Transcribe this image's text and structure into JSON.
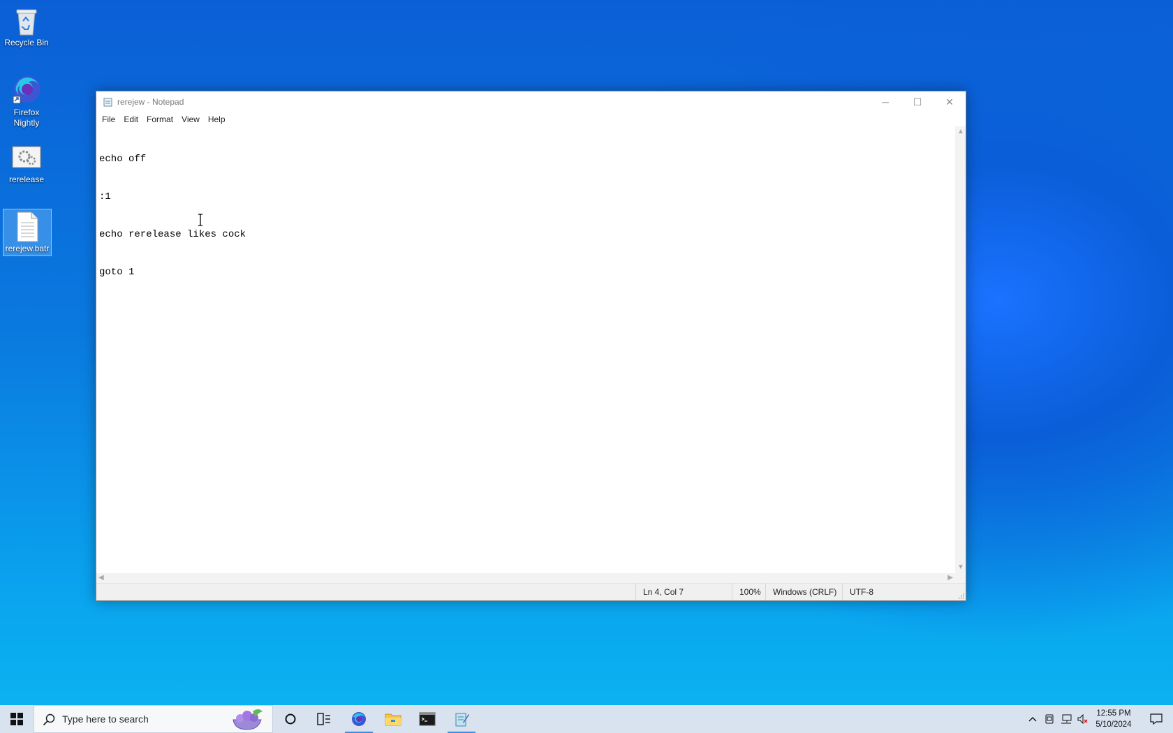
{
  "desktop": {
    "icons": [
      {
        "label": "Recycle Bin"
      },
      {
        "label": "Firefox Nightly"
      },
      {
        "label": "rerelease"
      },
      {
        "label": "rerejew.batr"
      }
    ]
  },
  "notepad": {
    "title": "rerejew - Notepad",
    "menu": [
      "File",
      "Edit",
      "Format",
      "View",
      "Help"
    ],
    "content_lines": [
      "echo off",
      ":1",
      "echo rerelease likes cock",
      "goto 1"
    ],
    "status": {
      "position": "Ln 4, Col 7",
      "zoom": "100%",
      "line_endings": "Windows (CRLF)",
      "encoding": "UTF-8"
    },
    "buttons": {
      "minimize": "─",
      "maximize": "☐",
      "close": "✕"
    }
  },
  "taskbar": {
    "search_placeholder": "Type here to search",
    "apps": [
      "cortana-icon",
      "task-view-icon",
      "firefox-icon",
      "file-explorer-icon",
      "terminal-icon",
      "notepad-icon"
    ],
    "clock": {
      "time": "12:55 PM",
      "date": "5/10/2024"
    }
  },
  "colors": {
    "accent": "#3a8ee8",
    "taskbar": "#d9e3ef"
  }
}
